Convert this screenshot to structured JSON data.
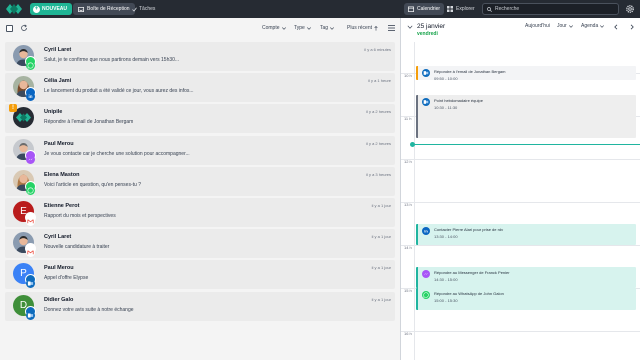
{
  "topbar": {
    "new_label": "NOUVEAU",
    "inbox_label": "Boîte de Réception",
    "tasks_label": "Tâches",
    "calendar_label": "Calendrier",
    "explore_label": "Explorer",
    "search_placeholder": "Recherche"
  },
  "toolbar": {
    "filters": [
      "Compte",
      "Type",
      "Tag"
    ],
    "sort_label": "Plus récent"
  },
  "conversations": [
    {
      "name": "Cyril Laret",
      "message": "Salut, je te confirme que nous partirons demain vers 15h30...",
      "time": "il y a 6 minutes",
      "channel": "whatsapp",
      "avatar": "photo-man-1"
    },
    {
      "name": "Célia Jami",
      "message": "Le lancement du produit a été validé ce jour, vous aurez des infos...",
      "time": "il y a 1 heure",
      "channel": "linkedin",
      "avatar": "photo-woman-1"
    },
    {
      "name": "Unipile",
      "message": "Répondre à l'email de Jonathan Bergam",
      "time": "il y a 2 heures",
      "channel": "none",
      "avatar": "unipile-logo",
      "warning": "!"
    },
    {
      "name": "Paul Merou",
      "message": "Je vous contacte car je cherche une solution pour accompagner...",
      "time": "il y a 2 heures",
      "channel": "messenger",
      "avatar": "photo-man-2"
    },
    {
      "name": "Elena Maston",
      "message": "Voici l'article en question, qu'en penses-tu ?",
      "time": "il y a 3 heures",
      "channel": "whatsapp",
      "avatar": "photo-woman-2"
    },
    {
      "name": "Etienne Perot",
      "message": "Rapport du mois et perspectives",
      "time": "il y a 1 jour",
      "channel": "gmail",
      "avatar": "letter",
      "letter": "E",
      "color": "#b91c1c"
    },
    {
      "name": "Cyril Laret",
      "message": "Nouvelle candidature à traiter",
      "time": "il y a 1 jour",
      "channel": "gmail",
      "avatar": "photo-man-1"
    },
    {
      "name": "Paul Merou",
      "message": "Appel d'offre Elypse",
      "time": "il y a 1 jour",
      "channel": "outlook",
      "avatar": "letter",
      "letter": "P",
      "color": "#3b82f6"
    },
    {
      "name": "Didier Galo",
      "message": "Donnez votre avis suite à notre échange",
      "time": "il y a 1 jour",
      "channel": "outlook",
      "avatar": "letter",
      "letter": "D",
      "color": "#3f8f3a"
    }
  ],
  "calendar": {
    "date": "25 janvier",
    "weekday": "vendredi",
    "today_label": "Aujourd'hui",
    "view_label": "Jour",
    "mode_label": "Agenda",
    "hours": [
      "10 h",
      "11 h",
      "12 h",
      "13 h",
      "14 h",
      "15 h",
      "16 h"
    ],
    "events": [
      {
        "title": "Répondre à l'email de Jonathan Bergam",
        "time": "09:50 - 10:00",
        "channel": "outlook",
        "bg": "#f3f4f6",
        "accent": "#f59e0b"
      },
      {
        "title": "Point hebdomadaire équipe",
        "time": "10:30 - 11:30",
        "channel": "outlook",
        "bg": "#eeeeee",
        "accent": "#6b7280"
      },
      {
        "title": "Contacter Pierre Alari pour prise de rdv",
        "time": "13:30 - 14:00",
        "channel": "linkedin",
        "bg": "#d7f3ee",
        "accent": "#20b5a0"
      },
      {
        "title": "Répondre au Messenger de Franck Penier",
        "time": "14:30 - 15:00",
        "channel": "messenger",
        "bg": "#d7f3ee",
        "accent": "#20b5a0"
      },
      {
        "title": "Répondre au WhatsApp de John Galon",
        "time": "15:00 - 15:30",
        "channel": "whatsapp",
        "bg": "#d7f3ee",
        "accent": "#20b5a0"
      }
    ]
  },
  "colors": {
    "brand": "#1fb595",
    "topbar": "#262b33",
    "now_line": "#20b5a0"
  }
}
